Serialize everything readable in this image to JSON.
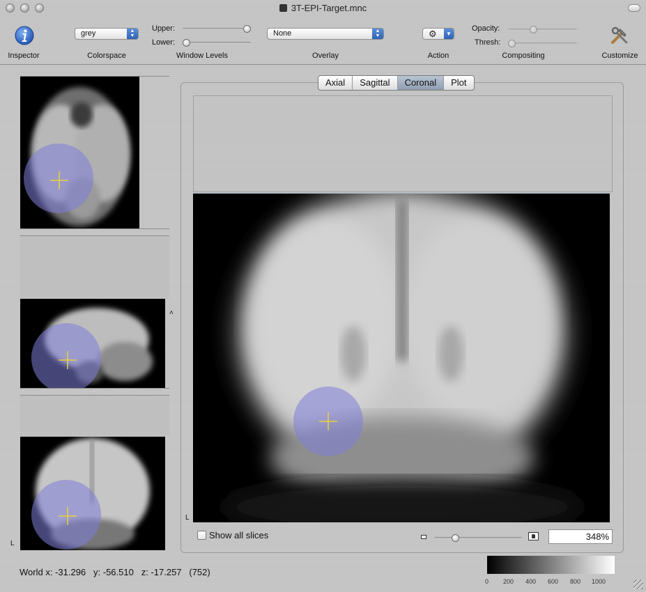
{
  "window": {
    "title": "3T-EPI-Target.mnc"
  },
  "toolbar": {
    "inspector_label": "Inspector",
    "colorspace_label": "Colorspace",
    "colorspace_value": "grey",
    "window_levels_label": "Window Levels",
    "upper_label": "Upper:",
    "lower_label": "Lower:",
    "upper_value": 1.0,
    "lower_value": 0.0,
    "overlay_label": "Overlay",
    "overlay_value": "None",
    "action_label": "Action",
    "compositing_label": "Compositing",
    "opacity_label": "Opacity:",
    "thresh_label": "Thresh:",
    "opacity_value": 0.35,
    "thresh_value": 0.0,
    "customize_label": "Customize"
  },
  "tabs": [
    {
      "label": "Axial",
      "active": false
    },
    {
      "label": "Sagittal",
      "active": false
    },
    {
      "label": "Coronal",
      "active": true
    },
    {
      "label": "Plot",
      "active": false
    }
  ],
  "view": {
    "orientation_marker": "L",
    "show_all_slices_label": "Show all slices",
    "show_all_slices_checked": false,
    "zoom_value": 0.22,
    "zoom_text": "348%"
  },
  "thumbnails": {
    "orientation_marker": "L",
    "splitter_glyph": "˄"
  },
  "status": {
    "world_label": "World x:",
    "x": "-31.296",
    "y_label": "y:",
    "y": "-56.510",
    "z_label": "z:",
    "z": "-17.257",
    "value": "(752)"
  },
  "colorbar": {
    "ticks": [
      "0",
      "200",
      "400",
      "600",
      "800",
      "1000"
    ]
  },
  "colors": {
    "overlay_blob": "#7d7dd8",
    "crosshair": "#e8d23a",
    "accent_blue": "#2f62b5"
  },
  "icons": {
    "inspector": "info-icon",
    "action": "gear-icon",
    "customize": "tools-icon",
    "zoom_small": "image-small-icon",
    "zoom_large": "image-large-icon"
  }
}
